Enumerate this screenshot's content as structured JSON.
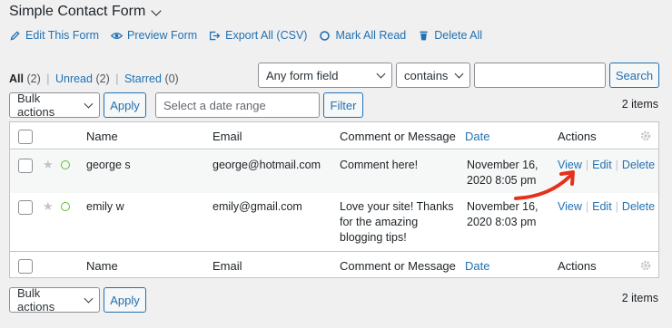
{
  "form_title": "Simple Contact Form",
  "toolbar": {
    "edit": "Edit This Form",
    "preview": "Preview Form",
    "export": "Export All (CSV)",
    "mark_read": "Mark All Read",
    "delete_all": "Delete All"
  },
  "filters": {
    "all": "All",
    "all_count": "(2)",
    "unread": "Unread",
    "unread_count": "(2)",
    "starred": "Starred",
    "starred_count": "(0)"
  },
  "search": {
    "field_select": "Any form field",
    "operator_select": "contains",
    "value": "",
    "button": "Search"
  },
  "bulk": {
    "select": "Bulk actions",
    "apply": "Apply"
  },
  "date_range": {
    "placeholder": "Select a date range",
    "filter_button": "Filter"
  },
  "items_count": "2 items",
  "columns": {
    "name": "Name",
    "email": "Email",
    "comment": "Comment or Message",
    "date": "Date",
    "actions": "Actions"
  },
  "rows": [
    {
      "name": "george s",
      "email": "george@hotmail.com",
      "comment": "Comment here!",
      "date_line1": "November 16,",
      "date_line2": "2020 8:05 pm"
    },
    {
      "name": "emily w",
      "email": "emily@gmail.com",
      "comment_line1": "Love your site! Thanks",
      "comment_line2": "for the amazing",
      "comment_line3": "blogging tips!",
      "date_line1": "November 16,",
      "date_line2": "2020 8:03 pm"
    }
  ],
  "row_actions": {
    "view": "View",
    "edit": "Edit",
    "delete": "Delete"
  },
  "colors": {
    "accent": "#2271b1",
    "annotation_arrow": "#e4311b"
  }
}
